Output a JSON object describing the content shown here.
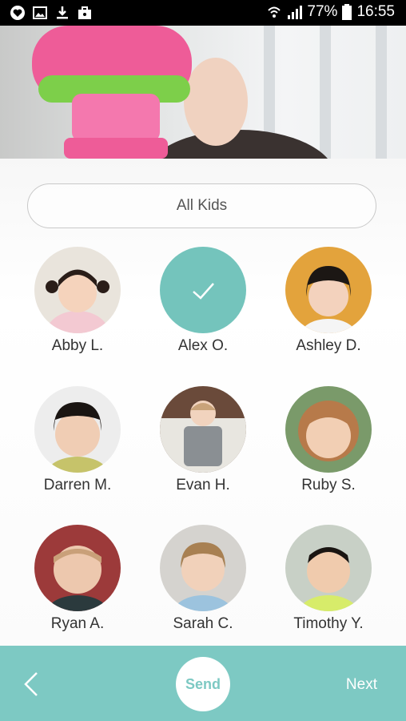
{
  "status_bar": {
    "battery": "77%",
    "time": "16:55",
    "icons_left": [
      "heart-chat-icon",
      "image-icon",
      "download-icon",
      "briefcase-icon"
    ],
    "icons_right": [
      "wifi-icon",
      "signal-icon",
      "battery-icon"
    ]
  },
  "filter": {
    "label": "All Kids"
  },
  "kids": [
    {
      "name": "Abby L.",
      "selected": false
    },
    {
      "name": "Alex O.",
      "selected": true
    },
    {
      "name": "Ashley D.",
      "selected": false
    },
    {
      "name": "Darren M.",
      "selected": false
    },
    {
      "name": "Evan H.",
      "selected": false
    },
    {
      "name": "Ruby S.",
      "selected": false
    },
    {
      "name": "Ryan A.",
      "selected": false
    },
    {
      "name": "Sarah C.",
      "selected": false
    },
    {
      "name": "Timothy Y.",
      "selected": false
    }
  ],
  "bottom_bar": {
    "send_label": "Send",
    "next_label": "Next"
  },
  "colors": {
    "accent": "#7dc9c3",
    "selected": "#74c4bc"
  }
}
